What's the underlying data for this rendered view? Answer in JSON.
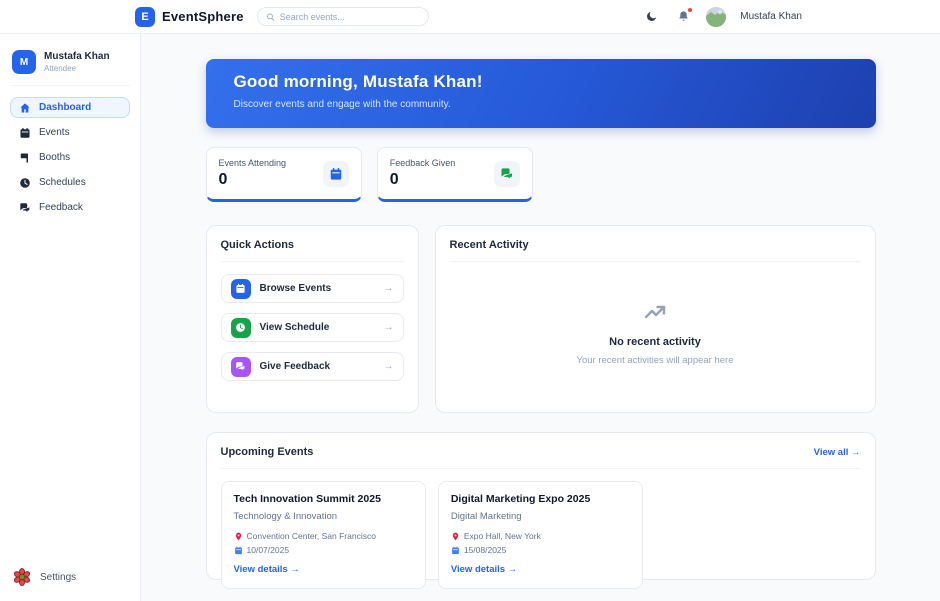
{
  "topbar": {
    "brand_initial": "E",
    "brand": "EventSphere",
    "search_placeholder": "Search events...",
    "user_name": "Mustafa Khan"
  },
  "sidebar": {
    "user": {
      "initial": "M",
      "name": "Mustafa Khan",
      "role": "Attendee"
    },
    "items": [
      {
        "label": "Dashboard",
        "icon": "home-icon",
        "active": true
      },
      {
        "label": "Events",
        "icon": "calendar-icon",
        "active": false
      },
      {
        "label": "Booths",
        "icon": "booth-icon",
        "active": false
      },
      {
        "label": "Schedules",
        "icon": "clock-icon",
        "active": false
      },
      {
        "label": "Feedback",
        "icon": "chat-icon",
        "active": false
      }
    ],
    "settings_label": "Settings"
  },
  "banner": {
    "title": "Good morning, Mustafa Khan!",
    "subtitle": "Discover events and engage with the community."
  },
  "stats": [
    {
      "label": "Events Attending",
      "value": "0",
      "icon": "calendar-icon",
      "accent": "#2563eb"
    },
    {
      "label": "Feedback Given",
      "value": "0",
      "icon": "chat-icon",
      "accent": "#16a34a"
    }
  ],
  "quick_actions": {
    "title": "Quick Actions",
    "arrow": "→",
    "items": [
      {
        "label": "Browse Events",
        "icon": "calendar-icon",
        "color": "#2563eb"
      },
      {
        "label": "View Schedule",
        "icon": "clock-icon",
        "color": "#16a34a"
      },
      {
        "label": "Give Feedback",
        "icon": "chat-icon",
        "color": "#a855f7"
      }
    ]
  },
  "recent_activity": {
    "title": "Recent Activity",
    "empty_title": "No recent activity",
    "empty_subtitle": "Your recent activities will appear here"
  },
  "upcoming": {
    "title": "Upcoming Events",
    "view_all": "View all →",
    "events": [
      {
        "name": "Tech Innovation Summit 2025",
        "category": "Technology & Innovation",
        "location": "Convention Center, San Francisco",
        "date": "10/07/2025",
        "link": "View details →"
      },
      {
        "name": "Digital Marketing Expo 2025",
        "category": "Digital Marketing",
        "location": "Expo Hall, New York",
        "date": "15/08/2025",
        "link": "View details →"
      }
    ]
  },
  "colors": {
    "accent_blue": "#2563eb",
    "accent_green": "#16a34a",
    "accent_purple": "#a855f7",
    "banner_gradient_start": "#3470ec",
    "banner_gradient_end": "#1e40af",
    "notification_dot": "#ef4444"
  }
}
